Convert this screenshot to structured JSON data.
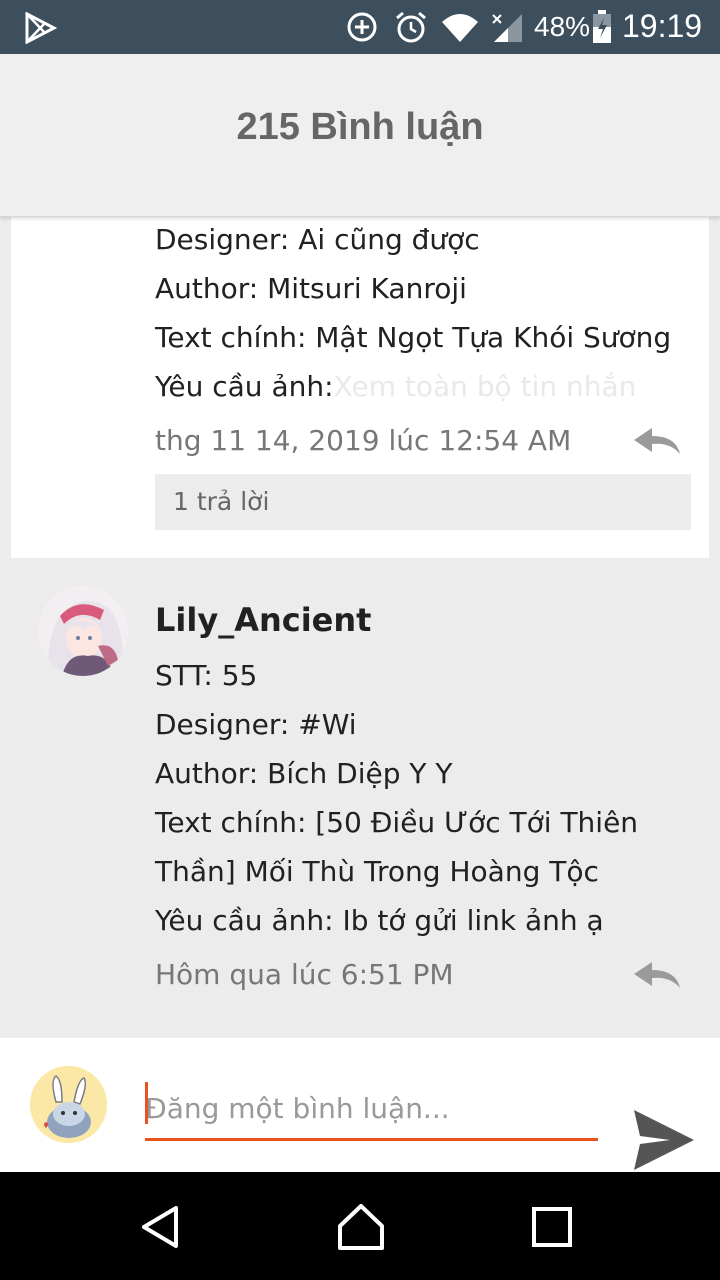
{
  "status_bar": {
    "battery": "48%",
    "time": "19:19"
  },
  "header": {
    "title": "215 Bình luận"
  },
  "comments": [
    {
      "lines": [
        {
          "label": "Designer: Ai cũng được"
        },
        {
          "label": "Author: Mitsuri Kanroji"
        },
        {
          "label": "Text chính: Mật Ngọt Tựa Khói Sương"
        }
      ],
      "last_line_prefix": "Yêu cầu ảnh:",
      "show_more": "Xem toàn bộ tin nhắn",
      "timestamp": "thg 11 14, 2019 lúc 12:54 AM",
      "replies": "1 trả lời"
    },
    {
      "username": "Lily_Ancient",
      "lines": [
        {
          "label": "STT: 55"
        },
        {
          "label": "Designer: #Wi"
        },
        {
          "label": "Author: Bích Diệp Y Y"
        },
        {
          "label": "Text chính: [50 Điều Ước Tới Thiên"
        },
        {
          "label": "Thần] Mối Thù Trong Hoàng Tộc"
        },
        {
          "label": "Yêu cầu ảnh: Ib tớ gửi link ảnh ạ"
        }
      ],
      "timestamp": "Hôm qua lúc 6:51 PM"
    }
  ],
  "composer": {
    "placeholder": "Đăng một bình luận..."
  },
  "colors": {
    "accent": "#e8541e",
    "status_bar": "#3d4f5c"
  }
}
